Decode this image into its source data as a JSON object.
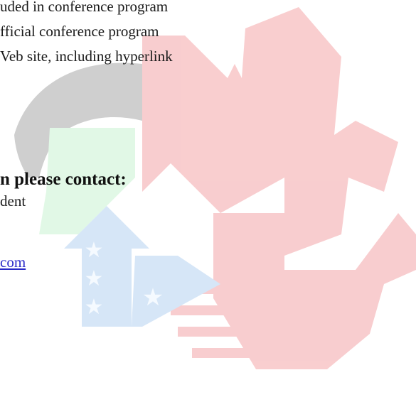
{
  "benefits": {
    "lines": [
      "uded in conference program",
      "fficial conference program",
      "Veb site, including hyperlink"
    ]
  },
  "contact": {
    "heading": "n please contact:",
    "role": "dent",
    "email_fragment": "com"
  },
  "watermark": {
    "red": "#f4a6a8",
    "green": "#c9f3d3",
    "gray": "#a8a8a8",
    "blue": "#b5d3f2",
    "star": "#eef6ff"
  }
}
